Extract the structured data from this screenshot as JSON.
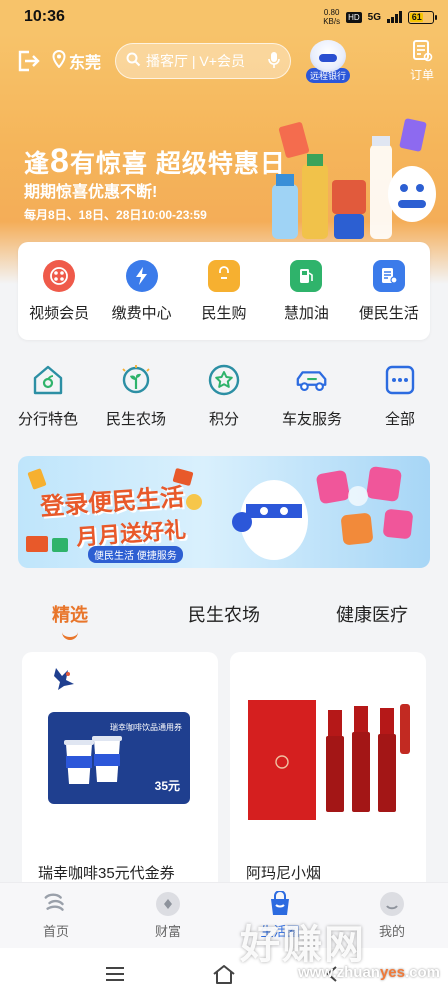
{
  "status_bar": {
    "time": "10:36",
    "speed_value": "0.80",
    "speed_unit": "KB/s",
    "hd": "HD",
    "network": "5G",
    "battery": "61"
  },
  "header": {
    "location": "东莞",
    "search_text": "播客厅 | V+会员",
    "remote_bank": "远程银行",
    "orders": "订单"
  },
  "promo": {
    "title_prefix": "逢",
    "title_num": "8",
    "title_rest": "有惊喜 超级特惠日",
    "subtitle": "期期惊喜优惠不断!",
    "time": "每月8日、18日、28日10:00-23:59"
  },
  "services": [
    {
      "label": "视频会员",
      "icon": "video-membership-icon",
      "color": "#ef5a4a"
    },
    {
      "label": "缴费中心",
      "icon": "payment-center-icon",
      "color": "#3b7bea"
    },
    {
      "label": "民生购",
      "icon": "shopping-bag-icon",
      "color": "#f6b030"
    },
    {
      "label": "慧加油",
      "icon": "fuel-pump-icon",
      "color": "#2fb36b"
    },
    {
      "label": "便民生活",
      "icon": "life-service-icon",
      "color": "#3b7bea"
    }
  ],
  "quick_links": [
    {
      "label": "分行特色",
      "icon": "branch-house-icon"
    },
    {
      "label": "民生农场",
      "icon": "farm-sprout-icon"
    },
    {
      "label": "积分",
      "icon": "points-star-icon"
    },
    {
      "label": "车友服务",
      "icon": "car-icon"
    },
    {
      "label": "全部",
      "icon": "all-dots-icon"
    }
  ],
  "banner": {
    "line1": "登录便民生活",
    "line2": "月月送好礼",
    "tag": "便民生活 便捷服务"
  },
  "tabs": [
    "精选",
    "民生农场",
    "健康医疗"
  ],
  "products": [
    {
      "name": "瑞幸咖啡35元代金券",
      "coupon_tag": "瑞幸咖啡饮品通用券",
      "coupon_price": "35元"
    },
    {
      "name": "阿玛尼小烟"
    }
  ],
  "bottom_nav": [
    {
      "label": "首页",
      "icon": "home-logo-icon"
    },
    {
      "label": "财富",
      "icon": "wealth-icon"
    },
    {
      "label": "生活圈",
      "icon": "life-circle-icon"
    },
    {
      "label": "我的",
      "icon": "profile-icon"
    }
  ],
  "watermark": {
    "big": "好赚网",
    "small_prefix": "www.zhuan",
    "small_accent": "yes",
    "small_suffix": ".com"
  },
  "colors": {
    "hero": "#f7c36a",
    "accent": "#e8752a",
    "blue": "#2c6be0"
  }
}
